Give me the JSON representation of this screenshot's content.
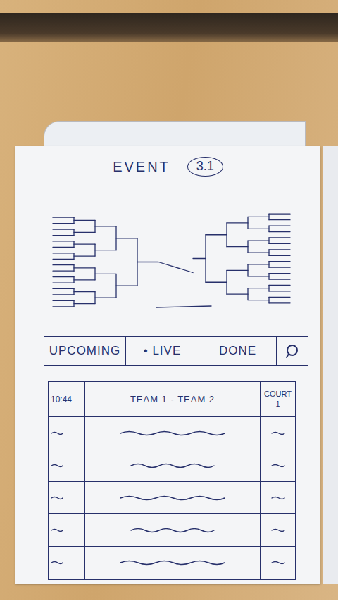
{
  "sheet": {
    "title": "EVENT",
    "page": "3.1"
  },
  "tabs": [
    {
      "label": "UPCOMING",
      "selected": false
    },
    {
      "label": "• LIVE",
      "selected": false
    },
    {
      "label": "DONE",
      "selected": false
    }
  ],
  "matches": [
    {
      "kind": "text",
      "time": "10:44",
      "teams": "TEAM 1 - TEAM 2",
      "court": "COURT 1"
    },
    {
      "kind": "placeholder"
    },
    {
      "kind": "placeholder"
    },
    {
      "kind": "placeholder"
    },
    {
      "kind": "placeholder"
    },
    {
      "kind": "placeholder"
    }
  ]
}
